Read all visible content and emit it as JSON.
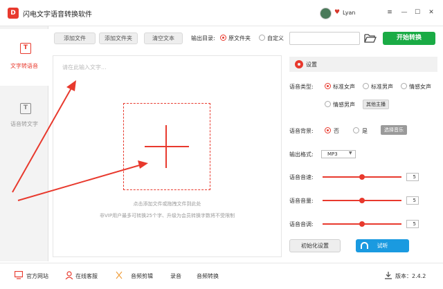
{
  "app": {
    "title": "闪电文字语音转换软件",
    "logo_glyph": "D",
    "user_name": "Lyan",
    "accent_color": "#e8392d"
  },
  "window_controls": {
    "menu": "≡",
    "minimize": "—",
    "maximize": "☐",
    "close": "✕"
  },
  "sidebar": {
    "items": [
      {
        "label": "文字转语音",
        "icon": "text-to-speech-icon",
        "glyph": "T",
        "active": true
      },
      {
        "label": "语音转文字",
        "icon": "speech-to-text-icon",
        "glyph": "T",
        "active": false
      }
    ]
  },
  "toolbar": {
    "add_file": "添加文件",
    "add_folder": "添加文件夹",
    "clear_text": "清空文本",
    "output_dir_label": "输出目录:",
    "output_options": [
      {
        "label": "原文件夹",
        "selected": true
      },
      {
        "label": "自定义",
        "selected": false
      }
    ],
    "path_value": "",
    "start_button": "开始转换"
  },
  "editor": {
    "placeholder": "请在此输入文字...",
    "drop_hint": "点击添加文件或拖拽文件到此处",
    "vip_hint": "非VIP用户最多可转换25个字、升级为会员转换字数将不受限制"
  },
  "settings": {
    "title": "设置",
    "voice_type_label": "语音类型:",
    "voice_options": [
      {
        "label": "标准女声",
        "selected": true
      },
      {
        "label": "标准男声",
        "selected": false
      },
      {
        "label": "情感女声",
        "selected": false
      },
      {
        "label": "情感男声",
        "selected": false
      }
    ],
    "other_anchor_button": "其他主播",
    "background_label": "语音背景:",
    "background_options": [
      {
        "label": "否",
        "selected": true
      },
      {
        "label": "是",
        "selected": false
      }
    ],
    "choose_music_button": "选择音乐",
    "format_label": "输出格式:",
    "format_value": "MP3",
    "speed_label": "语音音速:",
    "speed_value": "5",
    "volume_label": "语音音量:",
    "volume_value": "5",
    "pitch_label": "语音音调:",
    "pitch_value": "5",
    "init_button": "初始化设置",
    "listen_button": "试听"
  },
  "footer": {
    "website": "官方网站",
    "support": "在线客服",
    "audio_cut": "音频剪辑",
    "record": "录音",
    "audio_convert": "音频转换",
    "version_label": "版本：2.4.2"
  }
}
